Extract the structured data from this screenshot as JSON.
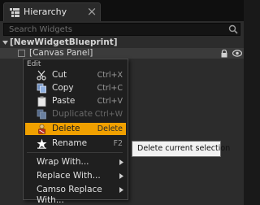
{
  "tab": {
    "title": "Hierarchy",
    "close_glyph": "×",
    "icon": "hierarchy-icon"
  },
  "search": {
    "placeholder": "Search Widgets",
    "value": "",
    "icon": "search-icon"
  },
  "tree": {
    "root_label": "[NewWidgetBlueprint]",
    "child_label": "[Canvas Panel]"
  },
  "context_menu": {
    "section_label": "Edit",
    "items": [
      {
        "label": "Cut",
        "shortcut": "Ctrl+X",
        "icon": "scissors-icon",
        "enabled": true,
        "selected": false
      },
      {
        "label": "Copy",
        "shortcut": "Ctrl+C",
        "icon": "copy-icon",
        "enabled": true,
        "selected": false
      },
      {
        "label": "Paste",
        "shortcut": "Ctrl+V",
        "icon": "paste-icon",
        "enabled": true,
        "selected": false
      },
      {
        "label": "Duplicate",
        "shortcut": "Ctrl+W",
        "icon": "duplicate-icon",
        "enabled": false,
        "selected": false
      },
      {
        "label": "Delete",
        "shortcut": "Delete",
        "icon": "delete-icon",
        "enabled": true,
        "selected": true
      },
      {
        "label": "Rename",
        "shortcut": "F2",
        "icon": "rename-icon",
        "enabled": true,
        "selected": false
      }
    ],
    "submenus": [
      {
        "label": "Wrap With..."
      },
      {
        "label": "Replace With..."
      },
      {
        "label": "Camso Replace With..."
      }
    ]
  },
  "tooltip": {
    "text": "Delete current selection"
  },
  "colors": {
    "highlight": "#f0a000",
    "panel_bg": "#2c2c2c",
    "menu_bg": "#1f1f1f",
    "tooltip_bg": "#f2f2f2"
  }
}
